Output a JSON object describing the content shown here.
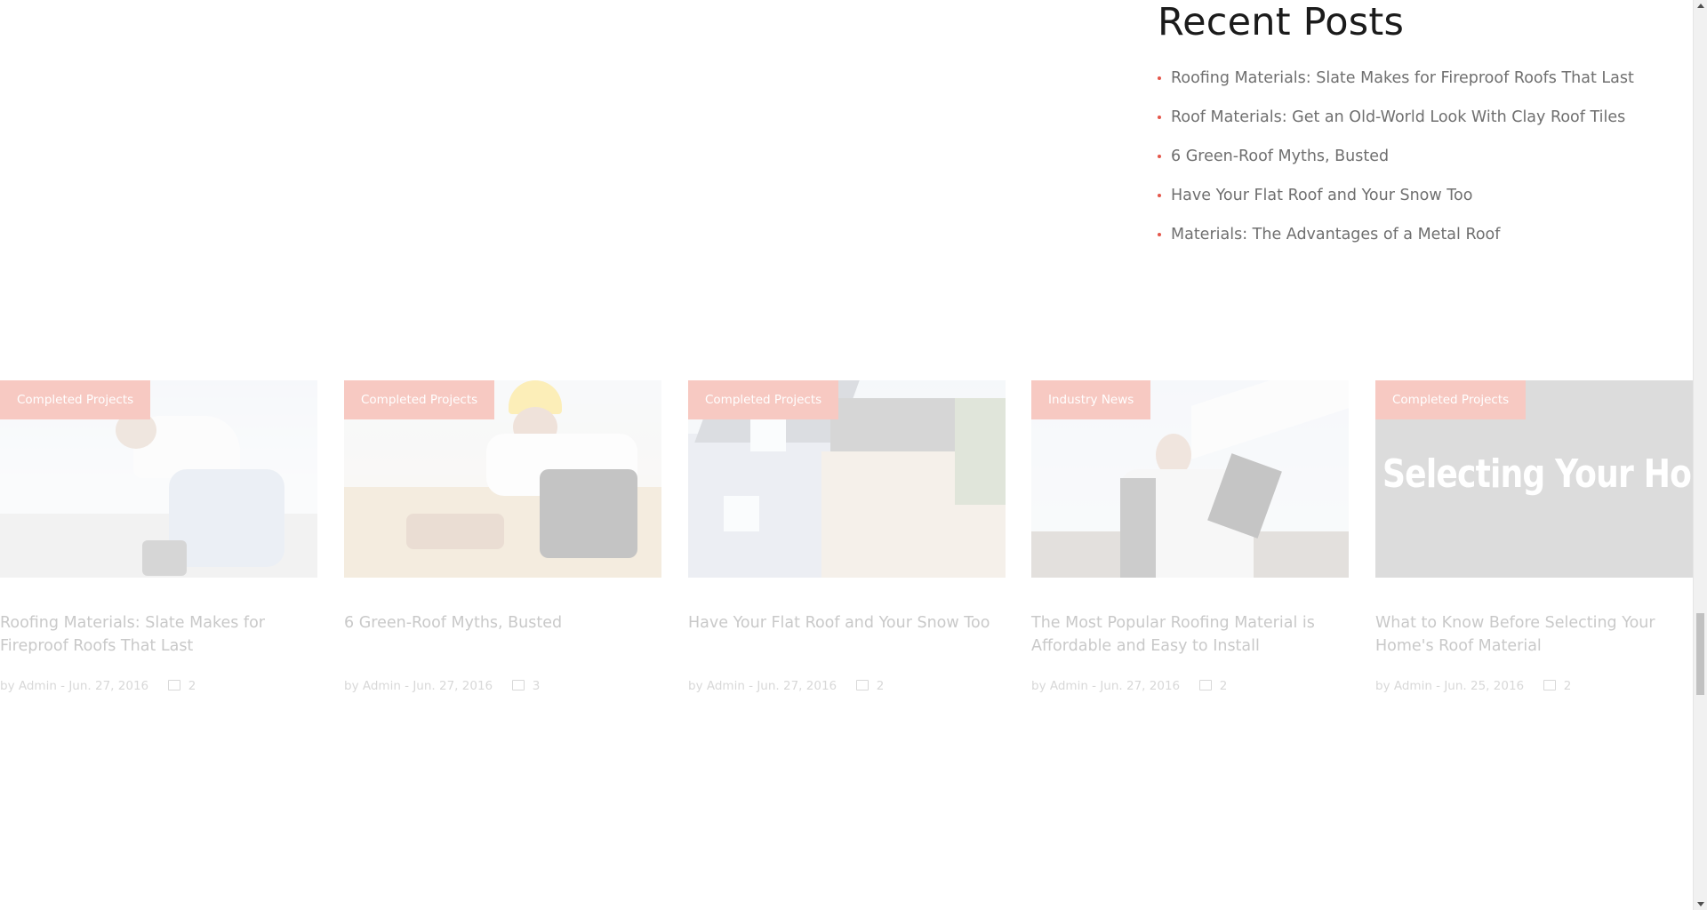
{
  "recent_posts": {
    "heading": "Recent Posts",
    "items": [
      {
        "label": "Roofing Materials: Slate Makes for Fireproof Roofs That Last"
      },
      {
        "label": "Roof Materials: Get an Old-World Look With Clay Roof Tiles"
      },
      {
        "label": "6 Green-Roof Myths, Busted"
      },
      {
        "label": "Have Your Flat Roof and Your Snow Too"
      },
      {
        "label": "Materials: The Advantages of a Metal Roof"
      }
    ]
  },
  "carousel": {
    "cards": [
      {
        "category": "Completed Projects",
        "title": "Roofing Materials: Slate Makes for Fireproof Roofs That Last",
        "meta": "by Admin - Jun. 27, 2016",
        "comments": "2"
      },
      {
        "category": "Completed Projects",
        "title": "6 Green-Roof Myths, Busted",
        "meta": "by Admin - Jun. 27, 2016",
        "comments": "3"
      },
      {
        "category": "Completed Projects",
        "title": "Have Your Flat Roof and Your Snow Too",
        "meta": "by Admin - Jun. 27, 2016",
        "comments": "2"
      },
      {
        "category": "Industry News",
        "title": "The Most Popular Roofing Material is Affordable and Easy to Install",
        "meta": "by Admin - Jun. 27, 2016",
        "comments": "2"
      },
      {
        "category": "Completed Projects",
        "title": "What to Know Before Selecting Your Home's Roof Material",
        "meta": "by Admin - Jun. 25, 2016",
        "comments": "2",
        "image_text": "Selecting Your Home&"
      }
    ]
  },
  "colors": {
    "bullet": "#e4574b",
    "tag_background": "#f7c9c2",
    "heading": "#1b1b1b",
    "link": "#6f6f6f"
  },
  "icons": {
    "comment": "comment-icon",
    "bullet": "bullet-dot-icon"
  }
}
